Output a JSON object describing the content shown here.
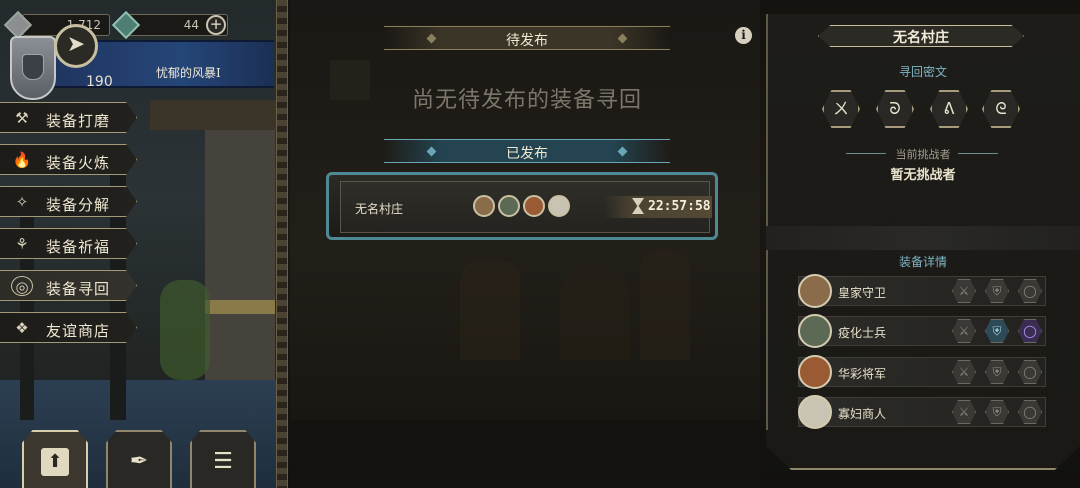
{
  "status": {
    "currency1_value": "1,712",
    "currency2_value": "44",
    "level": "190",
    "guild_name": "忧郁的风暴Ⅰ"
  },
  "menu": {
    "items": [
      {
        "label": "装备打磨",
        "icon": "hammer-icon",
        "glyph": "⚒"
      },
      {
        "label": "装备火炼",
        "icon": "flame-icon",
        "glyph": "🔥"
      },
      {
        "label": "装备分解",
        "icon": "disassemble-icon",
        "glyph": "✧"
      },
      {
        "label": "装备祈福",
        "icon": "pray-icon",
        "glyph": "⚘"
      },
      {
        "label": "装备寻回",
        "icon": "target-icon",
        "glyph": "◎",
        "active": true
      },
      {
        "label": "友谊商店",
        "icon": "fox-icon",
        "glyph": "❖"
      }
    ]
  },
  "bottom_tabs": [
    {
      "name": "upload-tab",
      "icon": "upload-icon",
      "glyph": "⬆",
      "active": true
    },
    {
      "name": "feather-tab",
      "icon": "feather-icon",
      "glyph": "✒"
    },
    {
      "name": "list-tab",
      "icon": "list-icon",
      "glyph": "☰"
    }
  ],
  "center": {
    "pending_header": "待发布",
    "pending_empty": "尚无待发布的装备寻回",
    "published_header": "已发布",
    "published_card": {
      "location": "无名村庄",
      "timer": "22:57:58"
    }
  },
  "right_panel": {
    "title": "无名村庄",
    "runes_label": "寻回密文",
    "runes": [
      {
        "icon": "rune-x-icon",
        "glyph": "ㄨ"
      },
      {
        "icon": "rune-swirl-icon",
        "glyph": "ᘐ"
      },
      {
        "icon": "rune-flag-icon",
        "glyph": "ᕕ"
      },
      {
        "icon": "rune-hook-icon",
        "glyph": "ᘓ"
      }
    ],
    "challenger_label": "当前挑战者",
    "challenger_value": "暂无挑战者",
    "details_label": "装备详情",
    "heroes": [
      {
        "name": "皇家守卫",
        "color": "#8a6b4a"
      },
      {
        "name": "疫化士兵",
        "color": "#5c6a55"
      },
      {
        "name": "华彩将军",
        "color": "#9a5a34"
      },
      {
        "name": "寡妇商人",
        "color": "#c9c3b3"
      }
    ]
  },
  "colors": {
    "accent_teal": "#4f8a94",
    "gold_border": "#a59a77",
    "banner_blue": "#254678"
  }
}
